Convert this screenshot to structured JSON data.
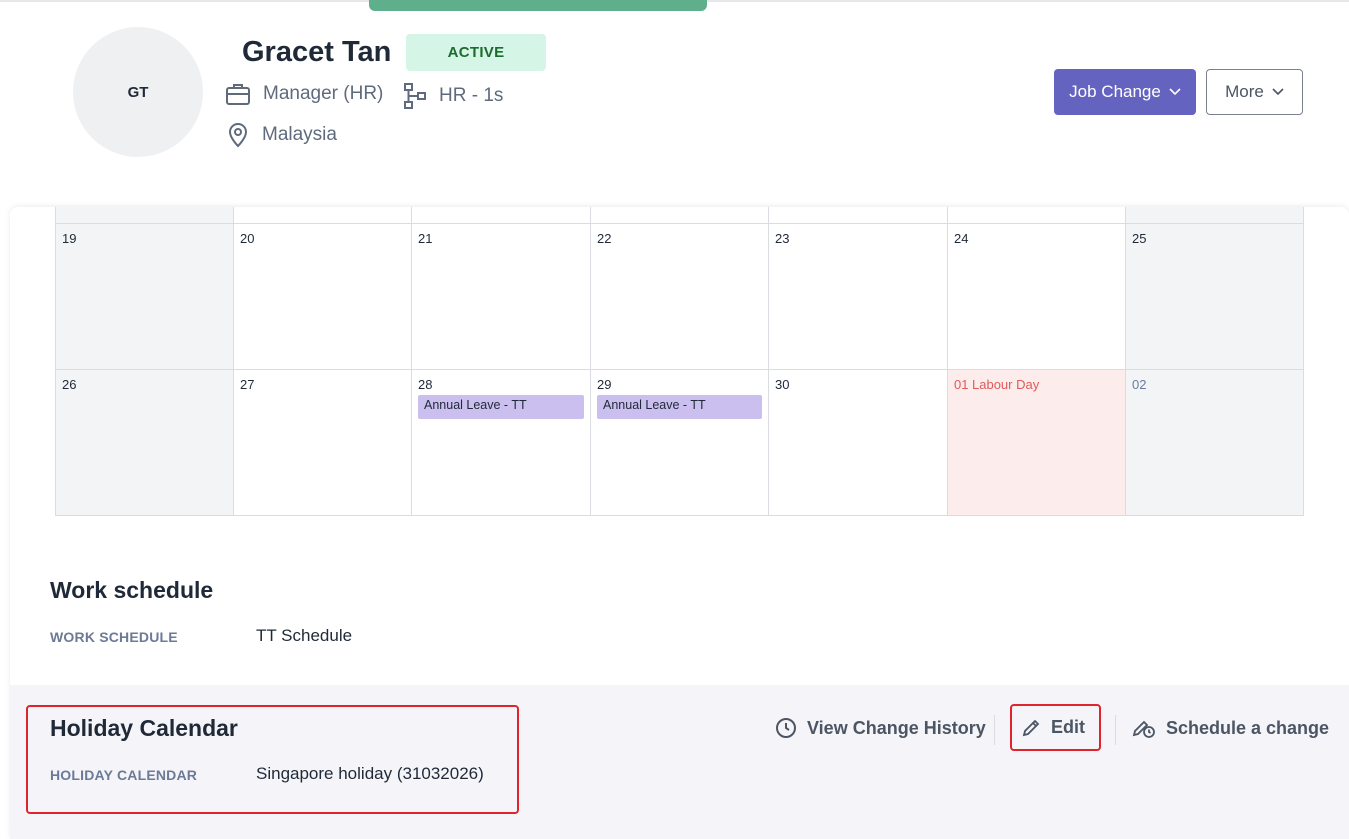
{
  "profile": {
    "initials": "GT",
    "name": "Gracet Tan",
    "status": "ACTIVE",
    "job_title": "Manager (HR)",
    "department": "HR - 1s",
    "location": "Malaysia"
  },
  "actions": {
    "job_change": "Job Change",
    "more": "More"
  },
  "calendar": {
    "week1": [
      {
        "day": "19"
      },
      {
        "day": "20"
      },
      {
        "day": "21"
      },
      {
        "day": "22"
      },
      {
        "day": "23"
      },
      {
        "day": "24"
      },
      {
        "day": "25"
      }
    ],
    "week2": [
      {
        "day": "26"
      },
      {
        "day": "27"
      },
      {
        "day": "28",
        "event": "Annual Leave - TT"
      },
      {
        "day": "29",
        "event": "Annual Leave - TT"
      },
      {
        "day": "30"
      },
      {
        "day": "01",
        "holiday": "Labour Day"
      },
      {
        "day": "02"
      }
    ]
  },
  "work_schedule": {
    "title": "Work schedule",
    "label": "WORK SCHEDULE",
    "value": "TT Schedule"
  },
  "holiday_calendar": {
    "title": "Holiday Calendar",
    "label": "HOLIDAY CALENDAR",
    "value": "Singapore holiday (31032026)",
    "view_history": "View Change History",
    "edit": "Edit",
    "schedule_change": "Schedule a change"
  },
  "colors": {
    "primary": "#6563c0",
    "active_badge_bg": "#d5f5e6",
    "event_bg": "#cbbff0",
    "holiday_bg": "#fdecec",
    "highlight": "#e0242c"
  }
}
